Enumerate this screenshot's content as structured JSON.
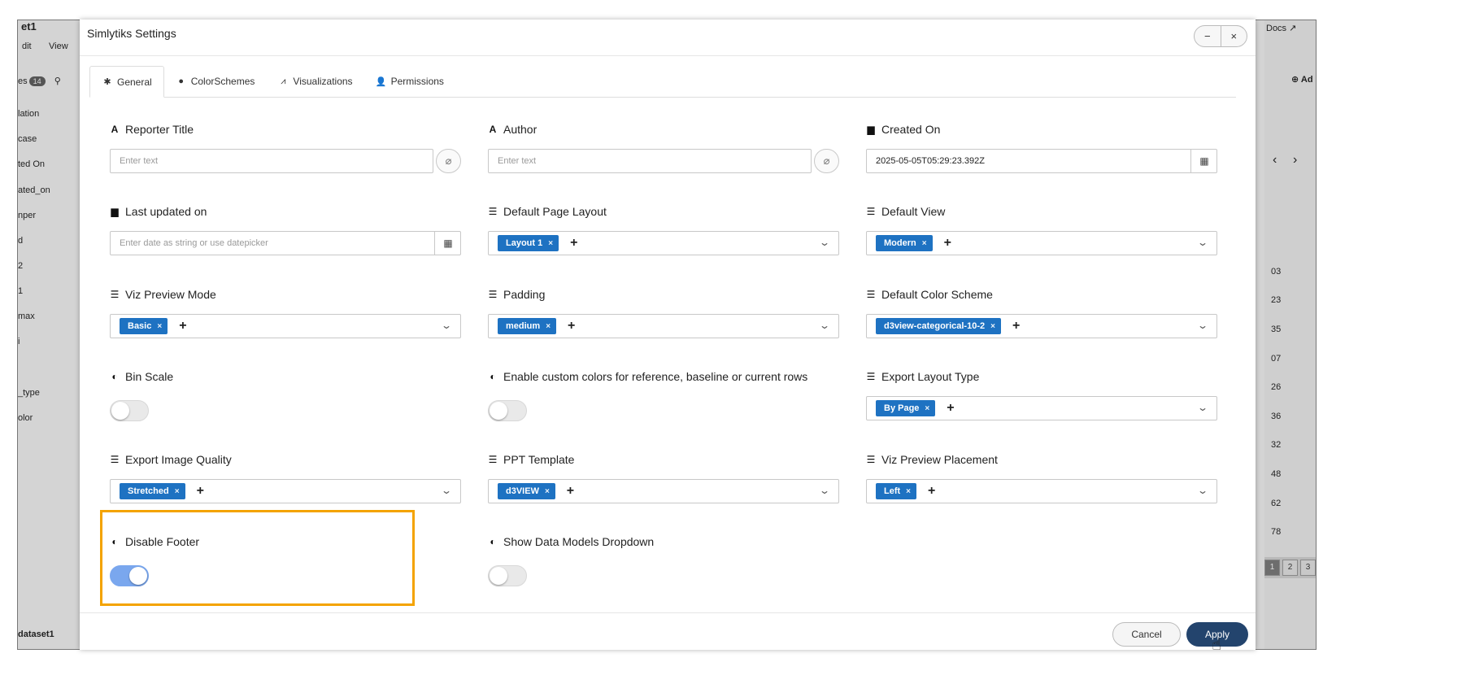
{
  "background": {
    "title_fragment": "et1",
    "menu": [
      "dit",
      "View"
    ],
    "filter_label": "es",
    "filter_count": "14",
    "sidebar_items": [
      "lation",
      "case",
      "ted On",
      "ated_on",
      "nper",
      "d",
      "2",
      "1",
      "max",
      "i",
      "",
      "_type",
      "olor"
    ],
    "footer_label": "dataset1",
    "docs_label": "Docs",
    "add_label": "Ad",
    "pager_prev": "‹",
    "pager_next": "›",
    "right_numbers": [
      "03",
      "23",
      "35",
      "07",
      "26",
      "36",
      "32",
      "48",
      "62",
      "78"
    ],
    "pages": [
      "1",
      "2",
      "3"
    ]
  },
  "modal": {
    "title": "Simlytiks Settings",
    "minimize_symbol": "−",
    "close_symbol": "×",
    "tabs": [
      {
        "label": "General",
        "icon": "gear-icon",
        "glyph": "✱"
      },
      {
        "label": "ColorSchemes",
        "icon": "palette-icon",
        "glyph": "●"
      },
      {
        "label": "Visualizations",
        "icon": "line-chart-icon",
        "glyph": "⩘"
      },
      {
        "label": "Permissions",
        "icon": "users-key-icon",
        "glyph": "👤"
      }
    ],
    "fields": {
      "reporter_title": {
        "label": "Reporter Title",
        "placeholder": "Enter text",
        "icon_glyph": "A"
      },
      "author": {
        "label": "Author",
        "placeholder": "Enter text",
        "icon_glyph": "A"
      },
      "created_on": {
        "label": "Created On",
        "value": "2025-05-05T05:29:23.392Z",
        "icon_glyph": "▆"
      },
      "last_updated_on": {
        "label": "Last updated on",
        "placeholder": "Enter date as string or use datepicker",
        "icon_glyph": "▆"
      },
      "default_page_layout": {
        "label": "Default Page Layout",
        "selected": "Layout 1",
        "icon_glyph": "☰"
      },
      "default_view": {
        "label": "Default View",
        "selected": "Modern",
        "icon_glyph": "☰"
      },
      "viz_preview_mode": {
        "label": "Viz Preview Mode",
        "selected": "Basic",
        "icon_glyph": "☰"
      },
      "padding": {
        "label": "Padding",
        "selected": "medium",
        "icon_glyph": "☰"
      },
      "default_color_scheme": {
        "label": "Default Color Scheme",
        "selected": "d3view-categorical-10-2",
        "icon_glyph": "☰"
      },
      "bin_scale": {
        "label": "Bin Scale",
        "on": false,
        "icon_glyph": "◐"
      },
      "enable_custom_colors": {
        "label": "Enable custom colors for reference, baseline or current rows",
        "on": false,
        "icon_glyph": "◐"
      },
      "export_layout_type": {
        "label": "Export Layout Type",
        "selected": "By Page",
        "icon_glyph": "☰"
      },
      "export_image_quality": {
        "label": "Export Image Quality",
        "selected": "Stretched",
        "icon_glyph": "☰"
      },
      "ppt_template": {
        "label": "PPT Template",
        "selected": "d3VIEW",
        "icon_glyph": "☰"
      },
      "viz_preview_placement": {
        "label": "Viz Preview Placement",
        "selected": "Left",
        "icon_glyph": "☰"
      },
      "disable_footer": {
        "label": "Disable Footer",
        "on": true,
        "icon_glyph": "◐"
      },
      "show_data_models_dropdown": {
        "label": "Show Data Models Dropdown",
        "on": false,
        "icon_glyph": "◐"
      }
    },
    "chip_remove": "×",
    "add_symbol": "+",
    "caret_symbol": "⌄",
    "attach_symbol": "⌀",
    "calendar_symbol": "▦",
    "cancel_label": "Cancel",
    "apply_label": "Apply",
    "colors": {
      "chip": "#1e72c2",
      "apply": "#23446d",
      "highlight": "#f4a300",
      "toggle_on": "#7aa7ee"
    }
  }
}
